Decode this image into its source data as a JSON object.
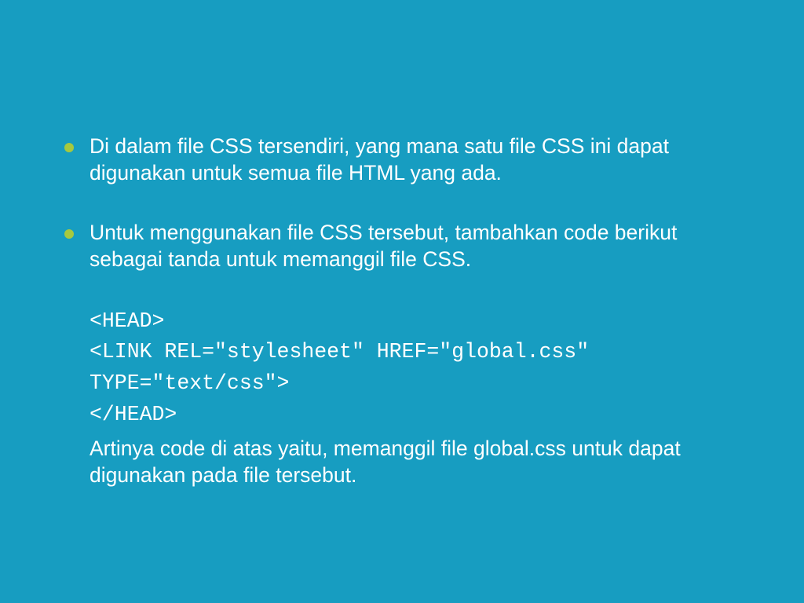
{
  "bullets": [
    "Di dalam file CSS tersendiri, yang mana satu file CSS ini dapat digunakan untuk semua file HTML yang ada.",
    "Untuk menggunakan file CSS tersebut, tambahkan code berikut sebagai tanda untuk memanggil file CSS."
  ],
  "code_lines": [
    "<HEAD>",
    "<LINK REL=\"stylesheet\" HREF=\"global.css\"",
    "TYPE=\"text/css\">",
    "</HEAD>"
  ],
  "closing": "Artinya code di atas yaitu, memanggil file global.css untuk dapat digunakan pada file tersebut."
}
